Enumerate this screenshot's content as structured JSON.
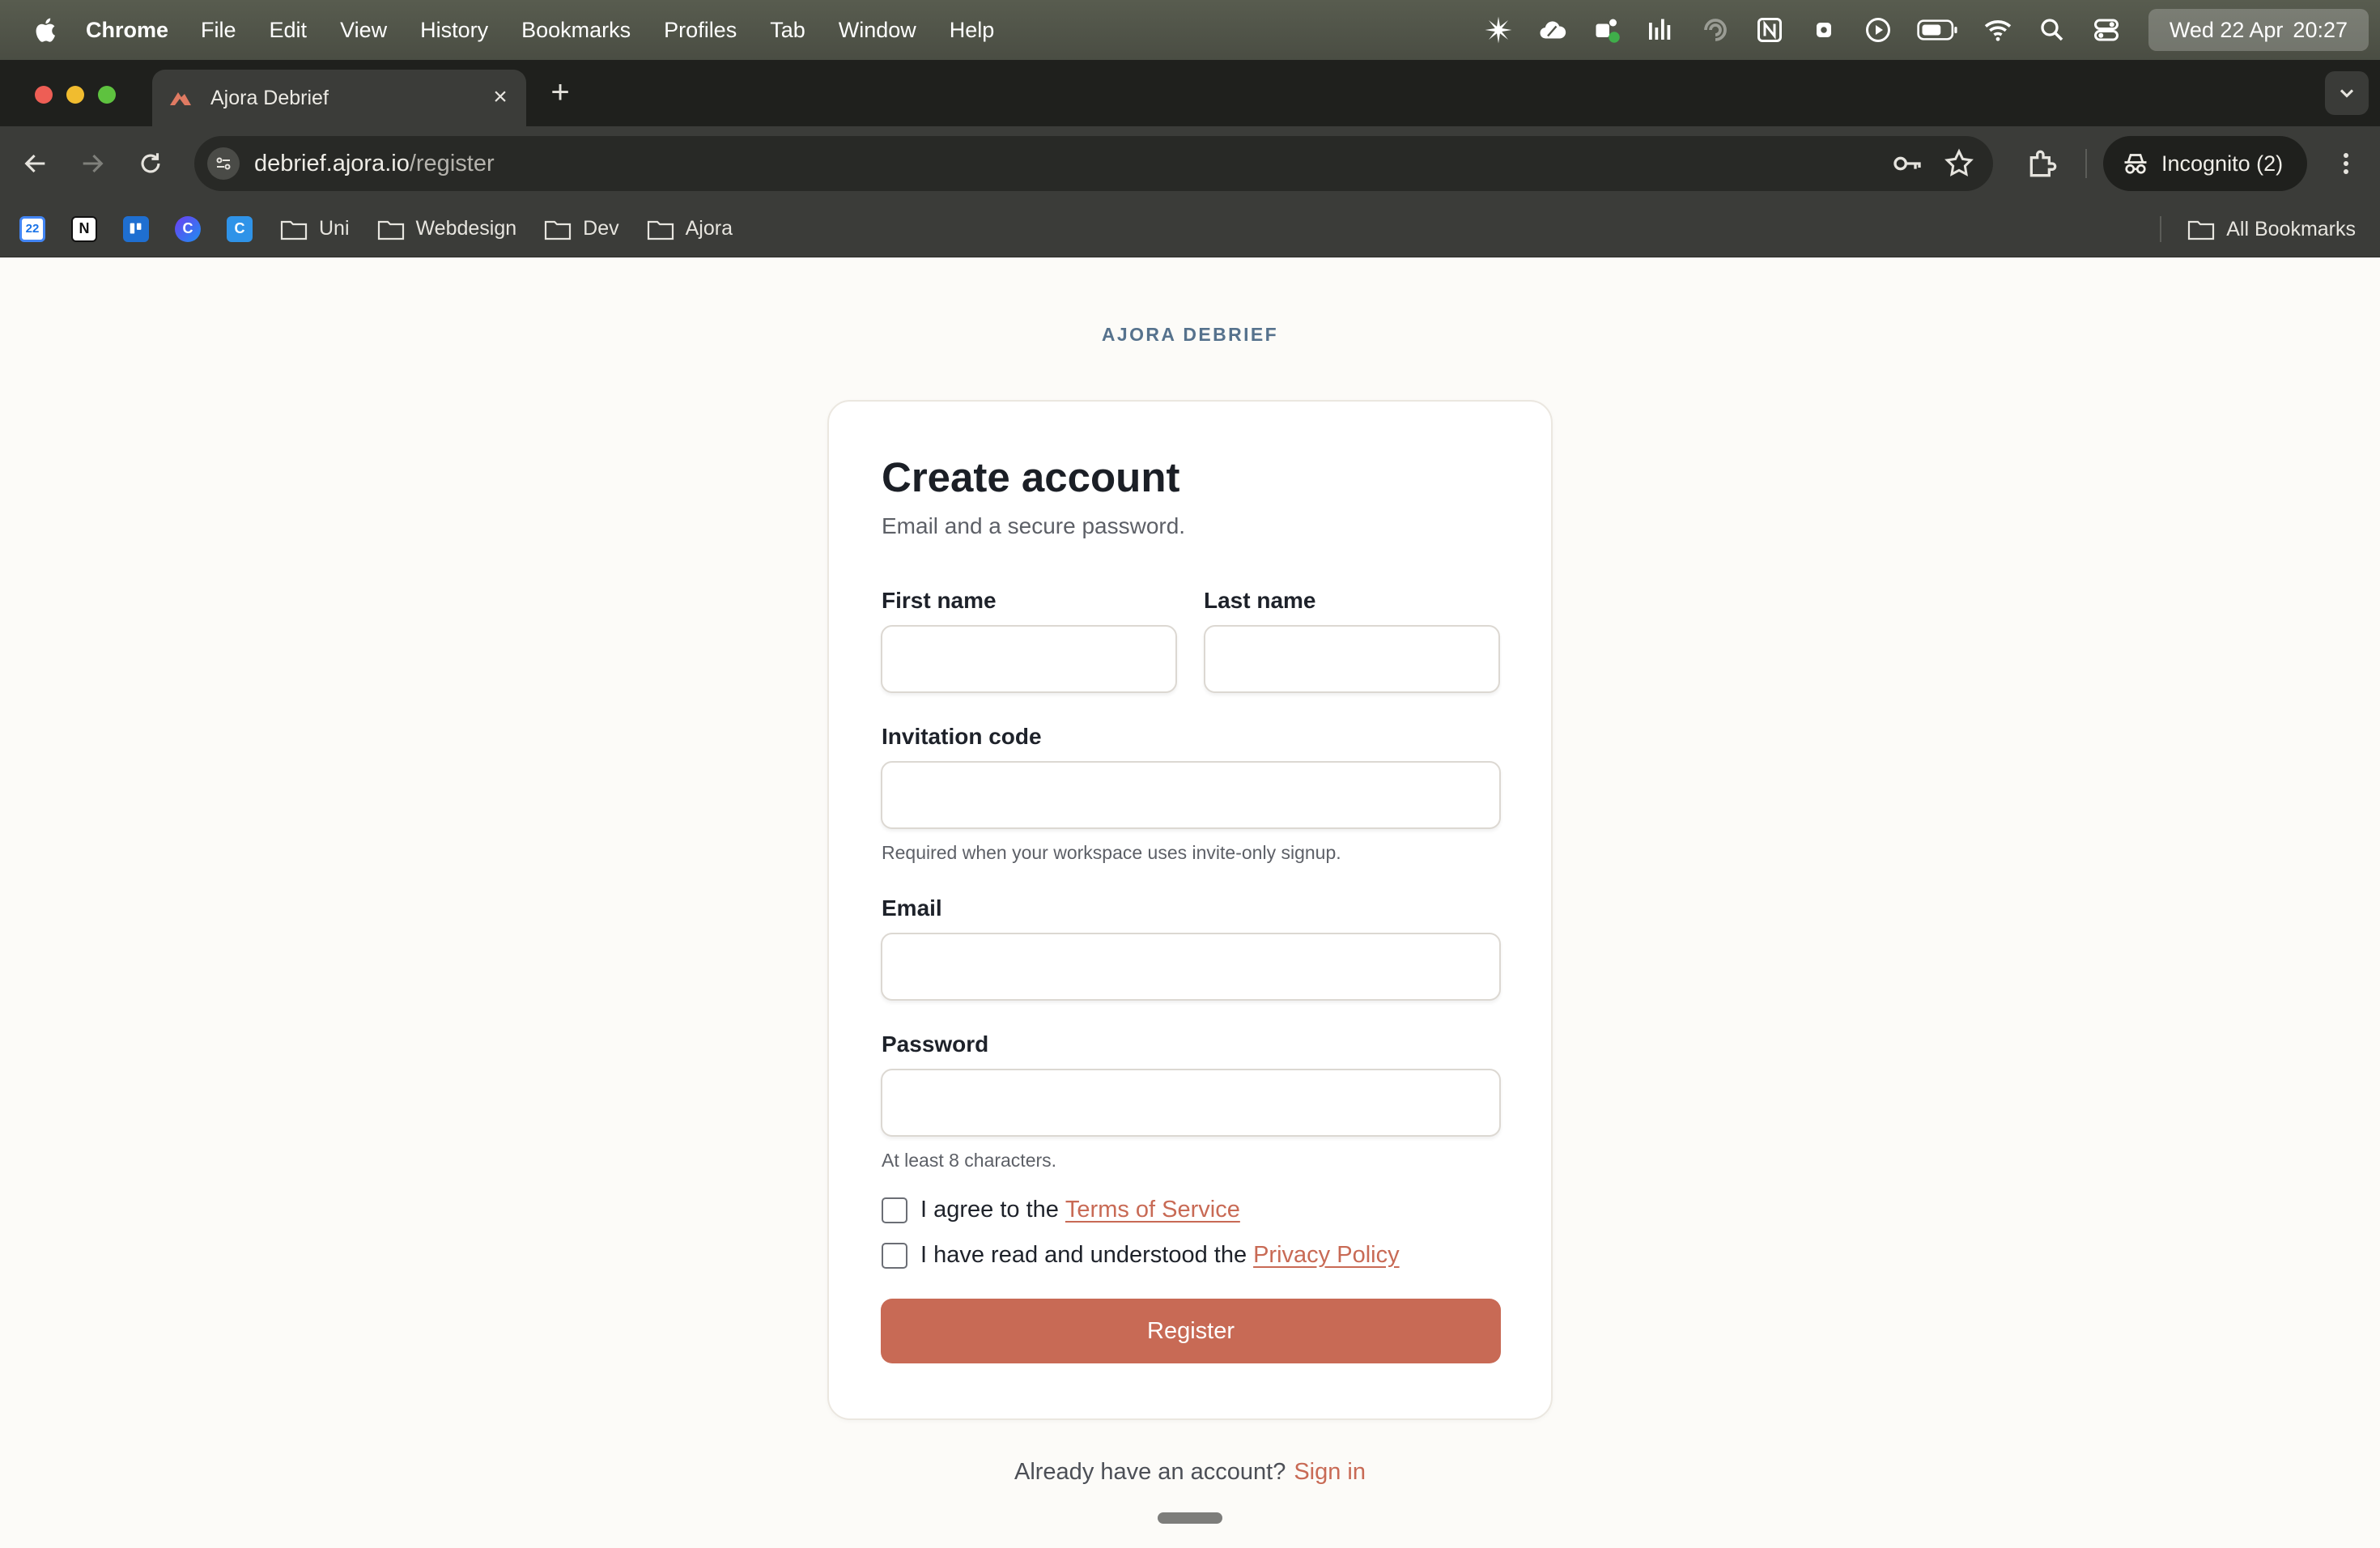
{
  "menubar": {
    "app_name": "Chrome",
    "items": [
      "File",
      "Edit",
      "View",
      "History",
      "Bookmarks",
      "Profiles",
      "Tab",
      "Window",
      "Help"
    ],
    "clock_date": "Wed 22 Apr",
    "clock_time": "20:27"
  },
  "browser": {
    "tab_title": "Ajora Debrief",
    "url_host": "debrief.ajora.io",
    "url_path": "/register",
    "incognito_label": "Incognito (2)",
    "bookmark_apps": [
      {
        "name": "calendar-icon",
        "glyph": "22"
      },
      {
        "name": "notion-icon",
        "glyph": "N"
      },
      {
        "name": "trello-icon",
        "glyph": ""
      },
      {
        "name": "chatgpt-icon",
        "glyph": "C"
      },
      {
        "name": "canva-icon",
        "glyph": "C"
      }
    ],
    "bookmark_folders": [
      "Uni",
      "Webdesign",
      "Dev",
      "Ajora"
    ],
    "all_bookmarks_label": "All Bookmarks"
  },
  "page": {
    "brand": "AJORA DEBRIEF",
    "title": "Create account",
    "subtitle": "Email and a secure password.",
    "fields": {
      "first_name": {
        "label": "First name",
        "value": ""
      },
      "last_name": {
        "label": "Last name",
        "value": ""
      },
      "invitation_code": {
        "label": "Invitation code",
        "value": "",
        "hint": "Required when your workspace uses invite-only signup."
      },
      "email": {
        "label": "Email",
        "value": ""
      },
      "password": {
        "label": "Password",
        "value": "",
        "hint": "At least 8 characters."
      }
    },
    "terms": {
      "prefix": "I agree to the",
      "link": "Terms of Service",
      "checked": false
    },
    "privacy": {
      "prefix": "I have read and understood the",
      "link": "Privacy Policy",
      "checked": false
    },
    "register_label": "Register",
    "signin_prompt": "Already have an account?",
    "signin_link": "Sign in"
  },
  "colors": {
    "accent": "#c86a55",
    "brand_text": "#56728d",
    "page_bg": "#fcfbf8"
  }
}
